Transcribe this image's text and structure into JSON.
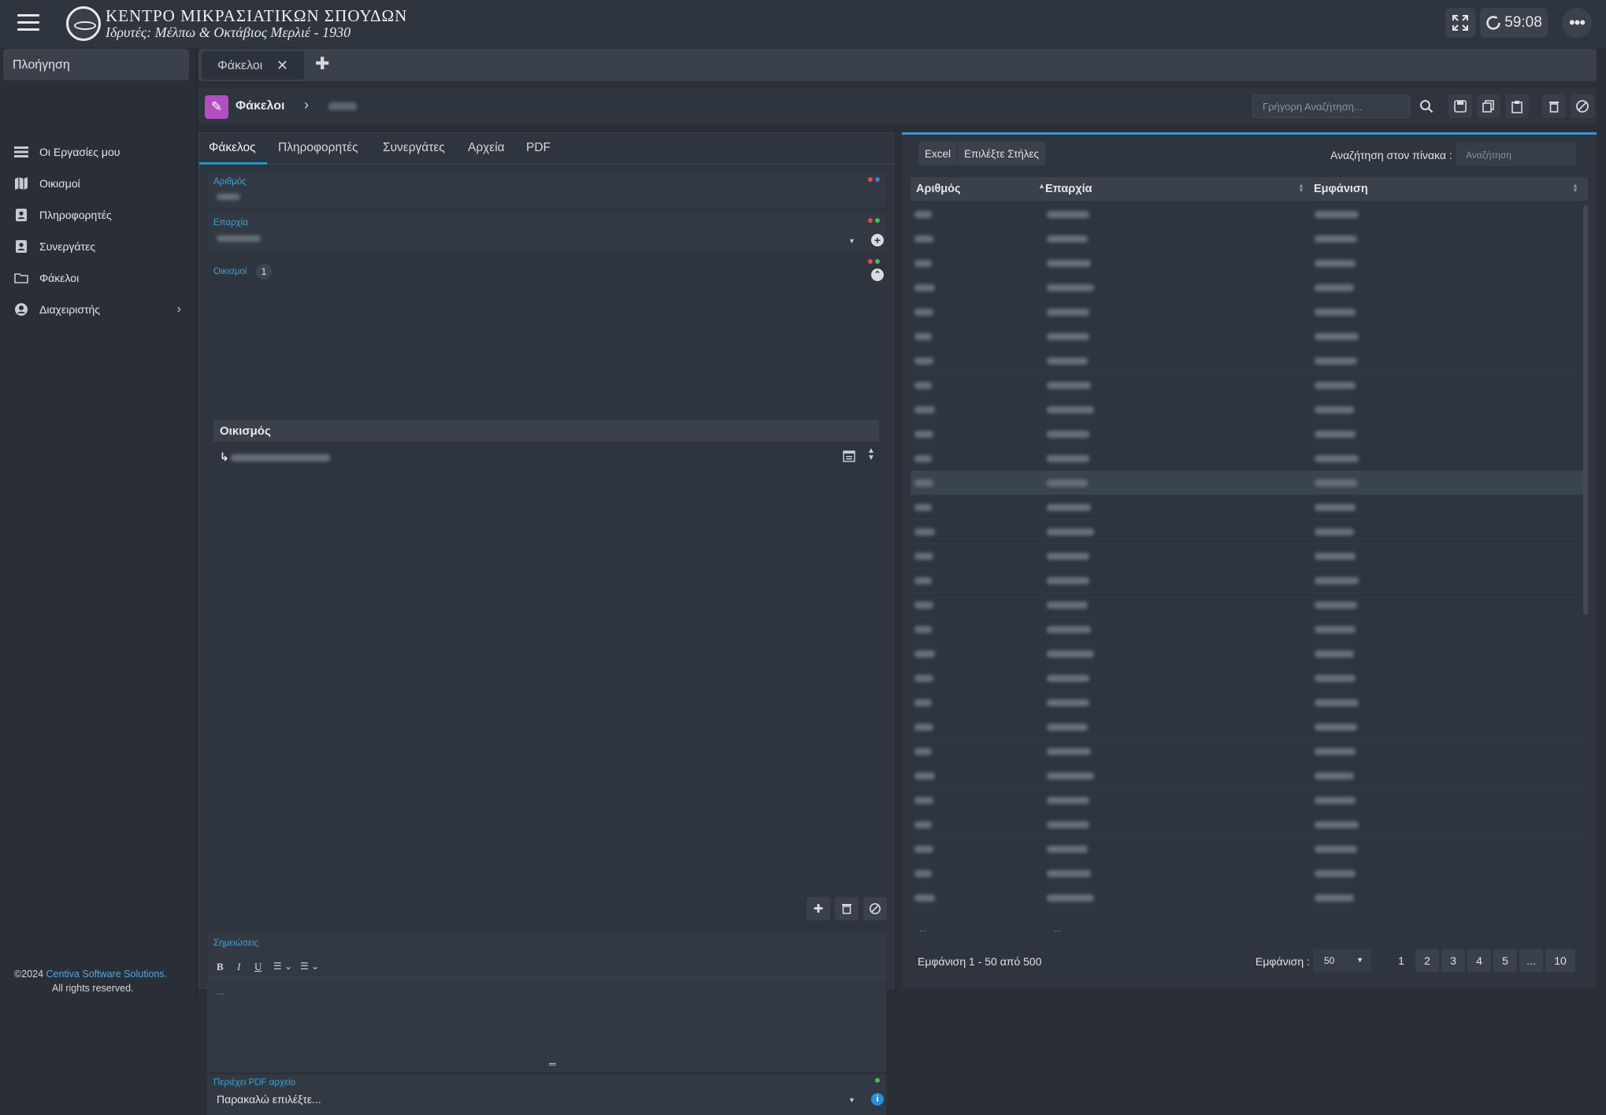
{
  "header": {
    "org_title": "ΚΕΝΤΡΟ ΜΙΚΡΑΣΙΑΤΙΚΩΝ ΣΠΟΥΔΩΝ",
    "org_subtitle": "Ιδρυτές: Μέλπω & Οκτάβιος Μερλιέ - 1930",
    "timer": "59:08"
  },
  "sidebar": {
    "title": "Πλοήγηση",
    "items": [
      {
        "label": "Οι Εργασίες μου",
        "icon": "tasks-icon"
      },
      {
        "label": "Οικισμοί",
        "icon": "map-icon"
      },
      {
        "label": "Πληροφορητές",
        "icon": "contact-book-icon"
      },
      {
        "label": "Συνεργάτες",
        "icon": "contact-book-icon"
      },
      {
        "label": "Φάκελοι",
        "icon": "folder-icon"
      },
      {
        "label": "Διαχειριστής",
        "icon": "user-circle-icon"
      }
    ]
  },
  "footer": {
    "copyright": "©2024",
    "company": "Centiva Software Solutions.",
    "rights": "All rights reserved."
  },
  "tabs": {
    "open_tab": "Φάκελοι"
  },
  "toolbar": {
    "breadcrumb": "Φάκελοι",
    "search_placeholder": "Γρήγορη Αναζήτηση..."
  },
  "form": {
    "tabs": [
      "Φάκελος",
      "Πληροφορητές",
      "Συνεργάτες",
      "Αρχεία",
      "PDF"
    ],
    "number_label": "Αριθμός",
    "province_label": "Επαρχία",
    "settlements_label": "Οικισμοί",
    "settlements_count": "1",
    "settlements_col": "Οικισμός",
    "notes_label": "Σημειώσεις",
    "notes_placeholder": "...",
    "pdf_label": "Περιέχει PDF αρχείο",
    "pdf_value": "Παρακαλώ επιλέξτε..."
  },
  "grid": {
    "excel": "Excel",
    "choose_cols": "Επιλέξτε Στήλες",
    "search_label": "Αναζήτηση στον πίνακα :",
    "search_placeholder": "Αναζήτηση",
    "columns": [
      "Αριθμός",
      "Επαρχία",
      "Εμφάνιση"
    ],
    "footer_dots": "...",
    "page_info": "Εμφάνιση 1 - 50 από 500",
    "show_label": "Εμφάνιση :",
    "page_size": "50",
    "pages": [
      "1",
      "2",
      "3",
      "4",
      "5",
      "...",
      "10"
    ]
  }
}
